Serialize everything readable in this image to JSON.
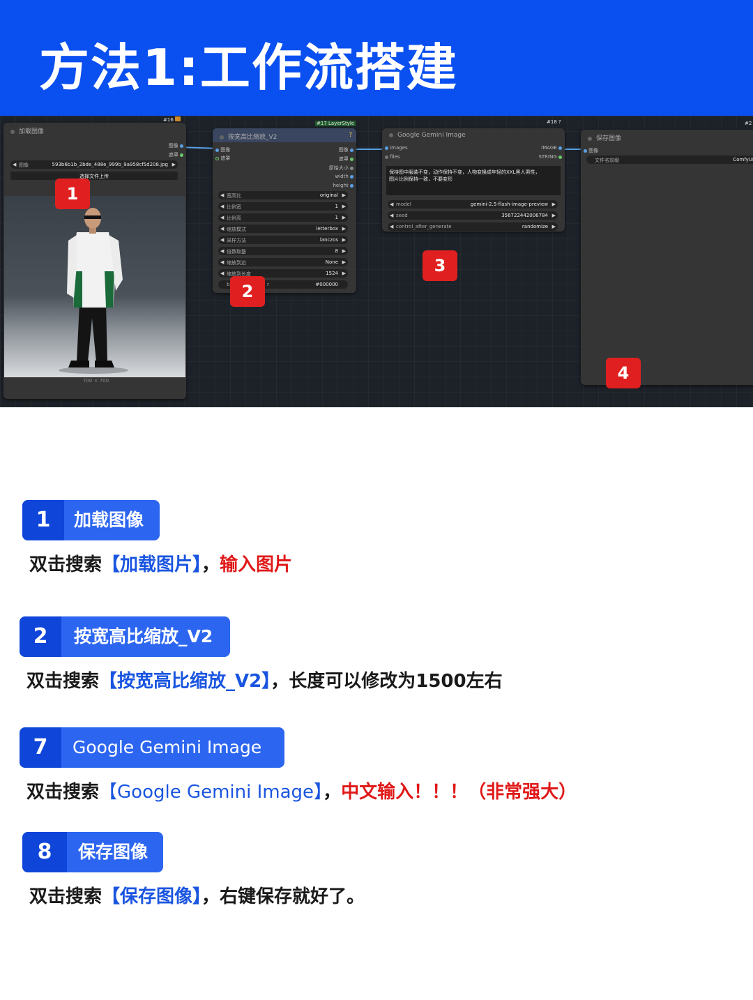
{
  "banner": {
    "title": "方法1:工作流搭建"
  },
  "canvas": {
    "load_node": {
      "tag": "#16",
      "title": "加载图像",
      "outputs": [
        "图像",
        "遮罩"
      ],
      "image_label": "图像",
      "image_value": "593b6b1b_2bde_488e_999b_9a958cf5d208.jpg",
      "upload_label": "选择文件上传",
      "size_caption": "700 × 700"
    },
    "scale_node": {
      "tag": "#17 LayerStyle",
      "title": "按宽高比缩放_V2",
      "help": "?",
      "inputs": [
        "图像",
        "遮罩"
      ],
      "outputs": [
        "图像",
        "遮罩",
        "原始大小",
        "width",
        "height"
      ],
      "widgets": [
        {
          "label": "宽高比",
          "value": "original"
        },
        {
          "label": "比例宽",
          "value": "1"
        },
        {
          "label": "比例高",
          "value": "1"
        },
        {
          "label": "缩放模式",
          "value": "letterbox"
        },
        {
          "label": "采样方法",
          "value": "lanczos"
        },
        {
          "label": "倍数取整",
          "value": "8"
        },
        {
          "label": "缩放到边",
          "value": "None"
        },
        {
          "label": "缩放到长度",
          "value": "1524"
        },
        {
          "label": "b",
          "label2": "r",
          "value": "#000000"
        }
      ]
    },
    "gemini_node": {
      "tag": "#18 ?",
      "title": "Google Gemini Image",
      "inputs": [
        "images",
        "files"
      ],
      "outputs": [
        "IMAGE",
        "STRING"
      ],
      "prompt": "保持图中服装不变，动作保持不变，人物变换成年轻的XXL黑人男性，\n图片比例保持一致，不要变形",
      "widgets": [
        {
          "label": "model",
          "value": "gemini-2.5-flash-image-preview"
        },
        {
          "label": "seed",
          "value": "356722442006784"
        },
        {
          "label": "control_after_generate",
          "value": "randomize"
        }
      ]
    },
    "save_node": {
      "tag": "#2",
      "title": "保存图像",
      "input": "图像",
      "prefix_label": "文件名前缀",
      "prefix_value": "ComfyUI"
    },
    "badges": [
      "1",
      "2",
      "3",
      "4"
    ]
  },
  "steps": [
    {
      "num": "1",
      "label": "加载图像",
      "desc_prefix": "双击搜索",
      "desc_highlight": "【加载图片】",
      "desc_sep": "，",
      "desc_extra": "输入图片"
    },
    {
      "num": "2",
      "label": "按宽高比缩放_V2",
      "desc_prefix": "双击搜索",
      "desc_highlight": "【按宽高比缩放_V2】",
      "desc_sep": "，",
      "desc_extra": "长度可以修改为1500左右"
    },
    {
      "num": "7",
      "label": "Google Gemini Image",
      "desc_prefix": "双击搜索",
      "desc_highlight": "【Google Gemini Image】",
      "desc_sep": "，",
      "desc_extra": "中文输入！！！（非常强大）"
    },
    {
      "num": "8",
      "label": "保存图像",
      "desc_prefix": "双击搜索",
      "desc_highlight": "【保存图像】",
      "desc_sep": "，",
      "desc_extra": "右键保存就好了。"
    }
  ],
  "colors": {
    "banner": "#0a4ff0",
    "pill": "#2c66f0",
    "pill_num": "#0f46d9",
    "highlight_blue": "#1a55e0",
    "highlight_red": "#e01818",
    "badge_red": "#e02020"
  }
}
